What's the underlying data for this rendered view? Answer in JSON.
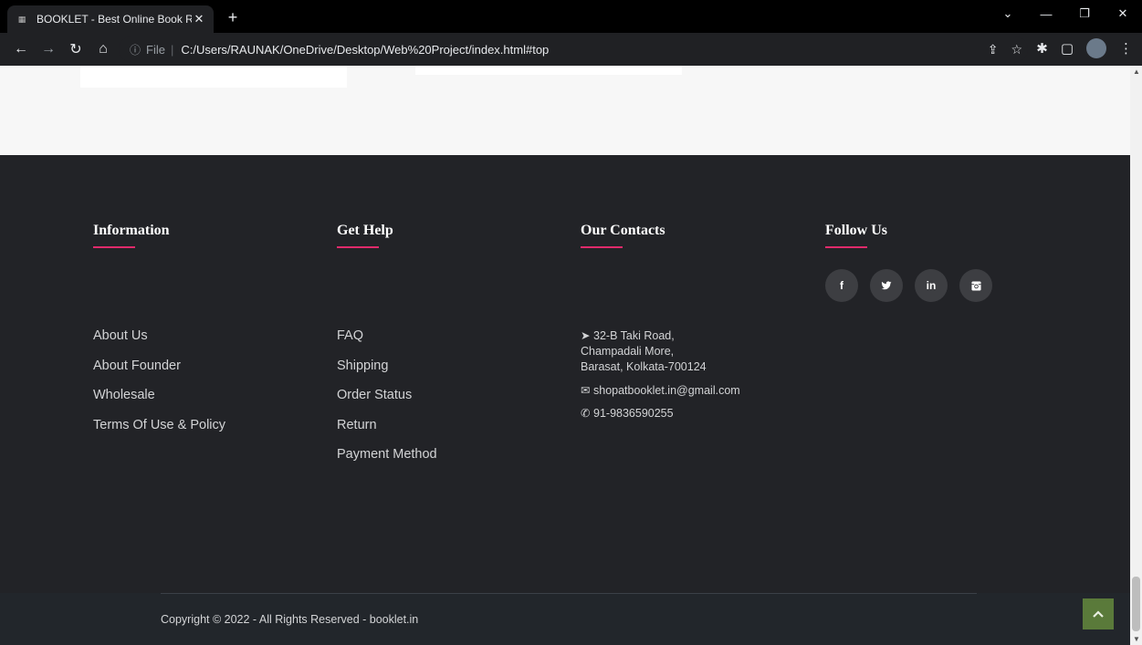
{
  "browser": {
    "tab_title": "BOOKLET - Best Online Book Rea",
    "tab_close": "✕",
    "new_tab": "+",
    "url": "C:/Users/RAUNAK/OneDrive/Desktop/Web%20Project/index.html#top",
    "file_label": "File",
    "info_icon": "ⓘ"
  },
  "footer": {
    "information": {
      "heading": "Information",
      "links": [
        "About Us",
        "About Founder",
        "Wholesale",
        "Terms Of Use & Policy"
      ]
    },
    "get_help": {
      "heading": "Get Help",
      "links": [
        "FAQ",
        "Shipping",
        "Order Status",
        "Return",
        "Payment Method"
      ]
    },
    "our_contacts": {
      "heading": "Our Contacts",
      "address_line1": "32-B Taki Road,",
      "address_line2": "Champadali More,",
      "address_line3": "Barasat, Kolkata-700124",
      "email": "shopatbooklet.in@gmail.com",
      "phone": "91-9836590255"
    },
    "follow_us": {
      "heading": "Follow Us",
      "socials": [
        {
          "icon": "facebook-icon",
          "glyph": "f"
        },
        {
          "icon": "twitter-icon",
          "glyph": "🐦"
        },
        {
          "icon": "linkedin-icon",
          "glyph": "in"
        },
        {
          "icon": "instagram-icon",
          "glyph": "◙"
        }
      ]
    },
    "copyright": "Copyright © 2022 - All Rights Reserved - booklet.in"
  },
  "colors": {
    "footer_bg": "#222327",
    "accent_underline": "#e02a6b",
    "back_to_top": "#5a7a3a"
  }
}
